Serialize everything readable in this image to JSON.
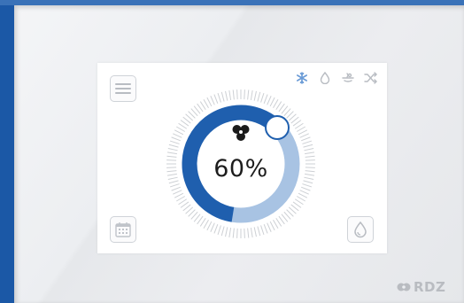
{
  "thermostat": {
    "humidity_percent": 60,
    "humidity_label": "60%",
    "modes": [
      {
        "icon": "snowflake-icon",
        "active": true
      },
      {
        "icon": "water-drop-icon",
        "active": false
      },
      {
        "icon": "fan-heat-icon",
        "active": false
      },
      {
        "icon": "shuffle-icon",
        "active": false
      }
    ]
  },
  "brand": {
    "logo_text": "RDZ"
  },
  "colors": {
    "accent": "#1f5fae",
    "ring_remainder": "#a8c3e3",
    "icon_gray": "#b8bcc2",
    "active_mode": "#6a9bd6"
  }
}
